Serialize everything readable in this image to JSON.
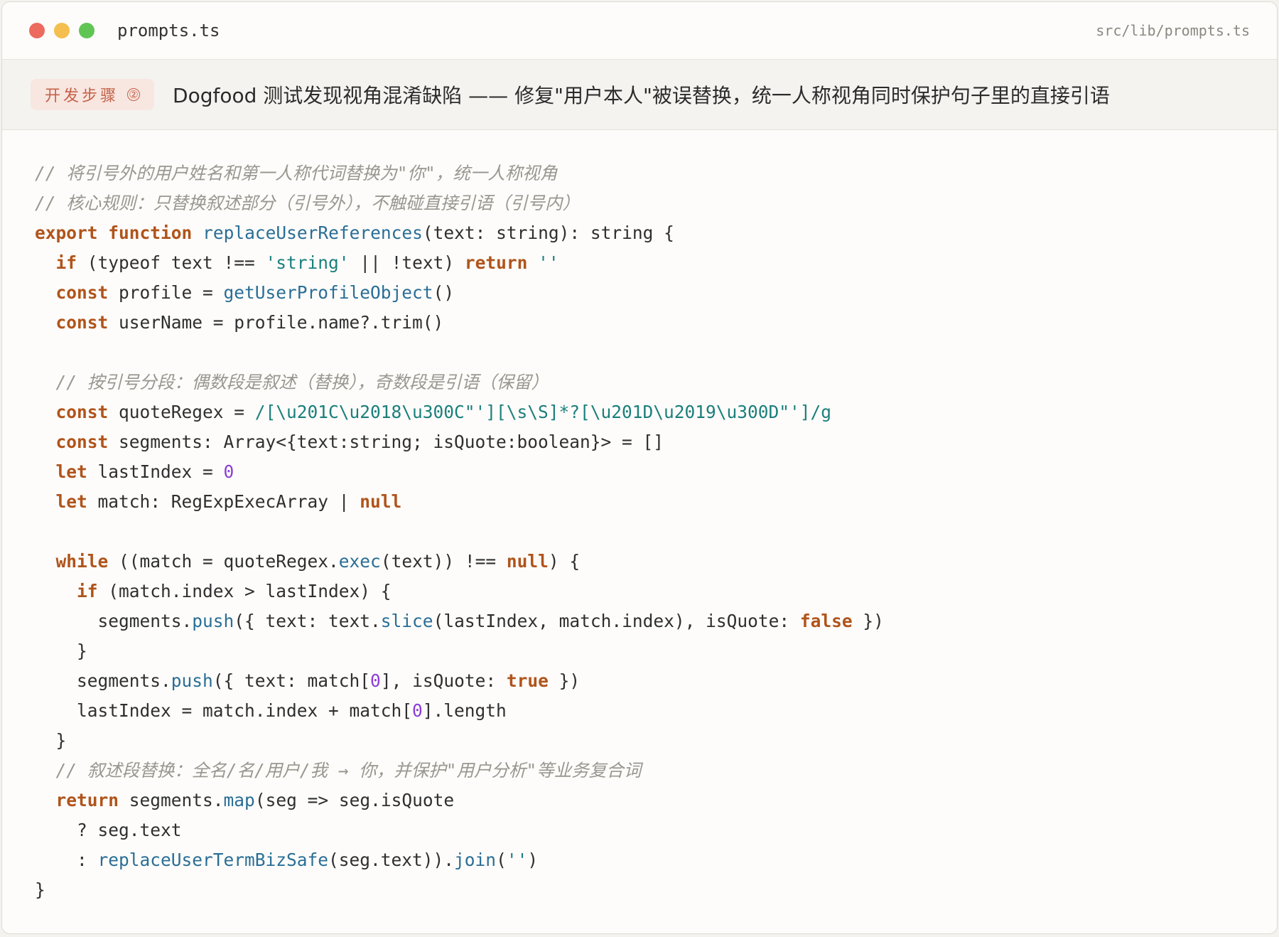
{
  "window": {
    "filename": "prompts.ts",
    "path": "src/lib/prompts.ts"
  },
  "step": {
    "badge_label": "开发步骤",
    "badge_number": "②",
    "title": "Dogfood 测试发现视角混淆缺陷 —— 修复\"用户本人\"被误替换，统一人称视角同时保护句子里的直接引语"
  },
  "code": {
    "comments": {
      "c1": "// 将引号外的用户姓名和第一人称代词替换为\"你\"，统一人称视角",
      "c2": "// 核心规则：只替换叙述部分（引号外），不触碰直接引语（引号内）",
      "c3": "// 按引号分段：偶数段是叙述（替换），奇数段是引语（保留）",
      "c4": "// 叙述段替换：全名/名/用户/我 → 你，并保护\"用户分析\"等业务复合词"
    },
    "regex": "/[\\u201C\\u2018\\u300C\"'][\\s\\S]*?[\\u201D\\u2019\\u300D\"']/g",
    "string_literal": "'string'",
    "empty_string": "''"
  },
  "colors": {
    "keyword": "#b0541b",
    "function": "#2a6e96",
    "string": "#1b7f7c",
    "number": "#8b3dd8",
    "comment": "#9a9690",
    "badge_bg": "#f8e6e0",
    "badge_text": "#c4624a"
  }
}
